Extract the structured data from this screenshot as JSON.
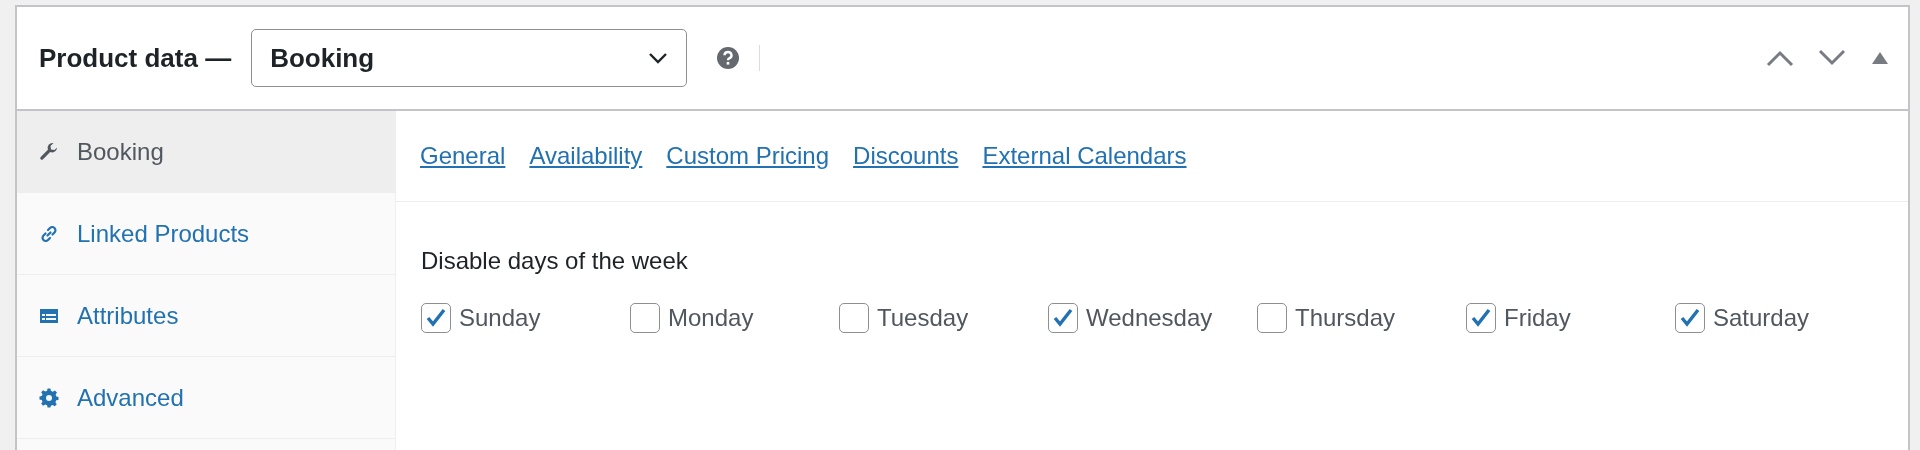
{
  "header": {
    "title": "Product data —",
    "product_type": {
      "value": "Booking"
    }
  },
  "sidebar": {
    "items": [
      {
        "label": "Booking",
        "kind": "wrench",
        "selected": true
      },
      {
        "label": "Linked Products",
        "kind": "link",
        "selected": false
      },
      {
        "label": "Attributes",
        "kind": "list",
        "selected": false
      },
      {
        "label": "Advanced",
        "kind": "gear",
        "selected": false
      }
    ]
  },
  "subtabs": [
    "General",
    "Availability",
    "Custom Pricing",
    "Discounts",
    "External Calendars"
  ],
  "disable_days": {
    "label": "Disable days of the week",
    "days": [
      {
        "label": "Sunday",
        "checked": true
      },
      {
        "label": "Monday",
        "checked": false
      },
      {
        "label": "Tuesday",
        "checked": false
      },
      {
        "label": "Wednesday",
        "checked": true
      },
      {
        "label": "Thursday",
        "checked": false
      },
      {
        "label": "Friday",
        "checked": true
      },
      {
        "label": "Saturday",
        "checked": true
      }
    ]
  }
}
